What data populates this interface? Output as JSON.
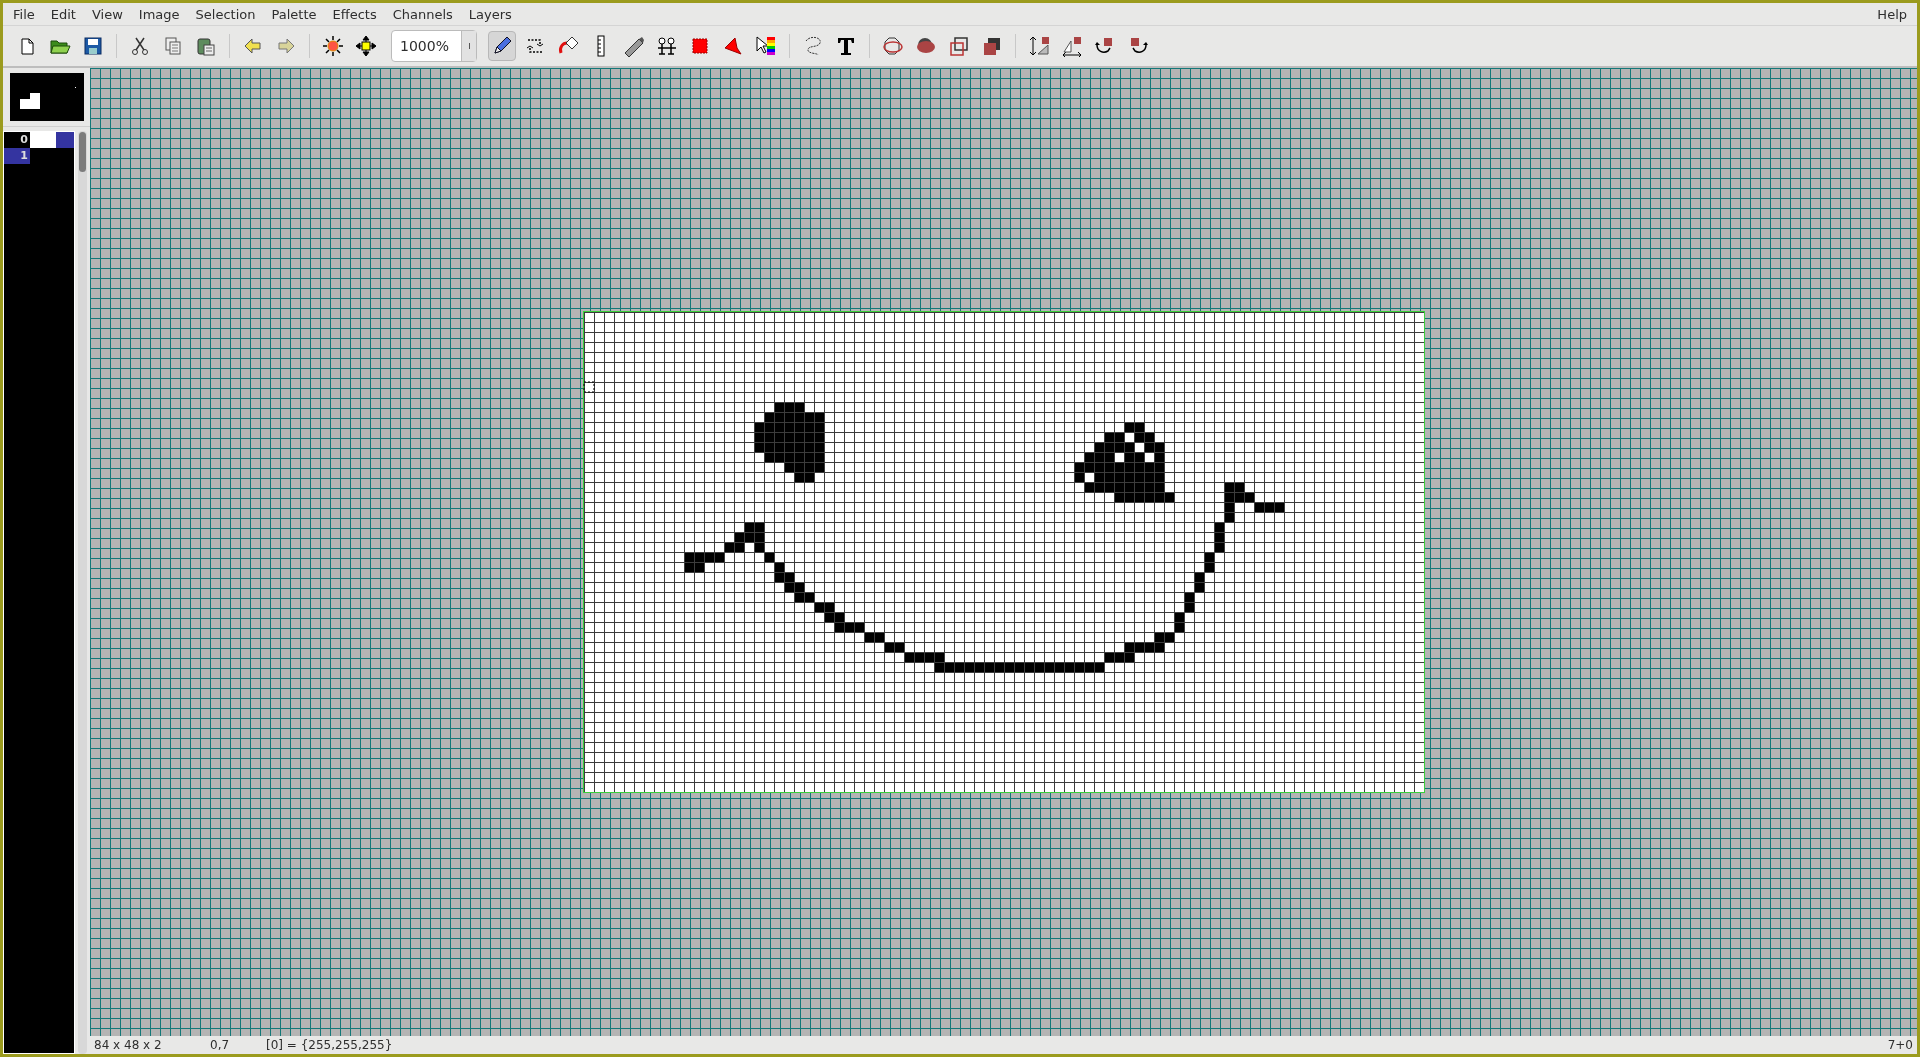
{
  "menu": [
    "File",
    "Edit",
    "View",
    "Image",
    "Selection",
    "Palette",
    "Effects",
    "Channels",
    "Layers"
  ],
  "help": "Help",
  "toolbar": {
    "zoom": "1000%",
    "tools": [
      {
        "selected": true
      },
      {
        "selected": false
      },
      {
        "selected": false
      },
      {
        "selected": false
      },
      {
        "selected": false
      },
      {
        "selected": false
      },
      {
        "selected": false
      },
      {
        "selected": false
      },
      {
        "selected": false
      }
    ]
  },
  "palette": [
    {
      "index": "0",
      "color": "#ffffff",
      "selected": false,
      "marked": true
    },
    {
      "index": "1",
      "selected": true,
      "marked": false
    }
  ],
  "status_bar": {
    "geometry": "84 x 48 x 2",
    "cursor": "0,7",
    "pixel": "[0] = {255,255,255}",
    "counter": "7+0"
  }
}
